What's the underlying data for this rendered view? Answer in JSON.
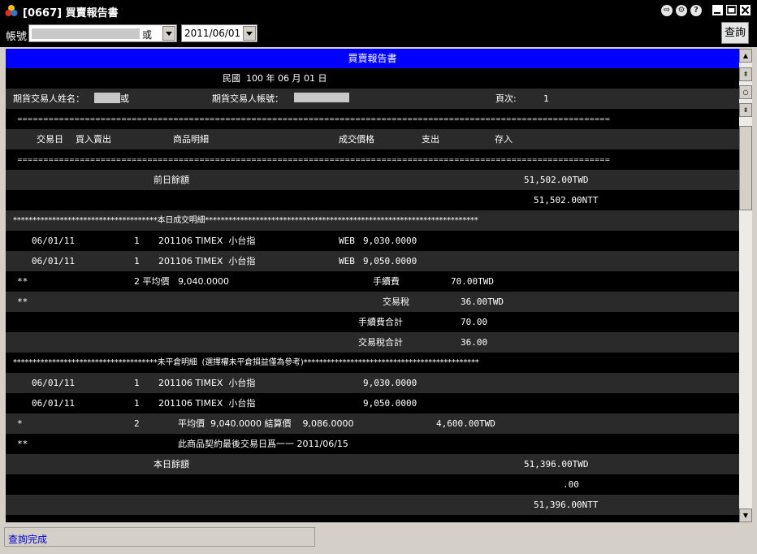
{
  "window": {
    "title": "[0667] 買賣報告書",
    "icons": [
      "app-logo-icon",
      "export-icon",
      "settings-icon",
      "help-icon",
      "minimize-icon",
      "maximize-icon",
      "close-icon"
    ]
  },
  "toolbar": {
    "account_label": "帳號",
    "account_value_suffix": "或",
    "date_value": "2011/06/01",
    "query_button": "查詢"
  },
  "report": {
    "header": "買賣報告書",
    "date_line": "民國  100 年 06 月 01 日",
    "trader_name_label": "期貨交易人姓名：",
    "trader_name_suffix": "或",
    "trader_account_label": "期貨交易人帳號：",
    "page_label": "頁次:",
    "page_value": "1",
    "separator": "==================================================================================================================",
    "columns": {
      "trade_date": "交易日",
      "buy_sell": "買入賣出",
      "product": "商品明細",
      "price": "成交價格",
      "expense": "支出",
      "deposit": "存入"
    },
    "prev_balance_label": "前日餘額",
    "prev_balance_twd": "51,502.00TWD",
    "prev_balance_ntt": "51,502.00NTT",
    "today_trades_title": "*************************************本日成交明細**********************************************************************",
    "trades": [
      {
        "date": "06/01/11",
        "qty": "1",
        "product": "201106 TIMEX  小台指",
        "channel": "WEB",
        "price": "9,030.0000"
      },
      {
        "date": "06/01/11",
        "qty": "1",
        "product": "201106 TIMEX  小台指",
        "channel": "WEB",
        "price": "9,050.0000"
      }
    ],
    "summary": {
      "marker": "**",
      "qty_avg": "2 平均價   9,040.0000",
      "fee_label": "手續費",
      "fee_value": "70.00TWD",
      "tax_marker": "**",
      "tax_label": "交易稅",
      "tax_value": "36.00TWD",
      "fee_total_label": "手續費合計",
      "fee_total_value": "70.00",
      "tax_total_label": "交易稅合計",
      "tax_total_value": "36.00"
    },
    "open_title": "*************************************未平倉明細  (選擇權未平倉損益僅為參考)*********************************************",
    "open_positions": [
      {
        "date": "06/01/11",
        "qty": "1",
        "product": "201106 TIMEX  小台指",
        "price": "9,030.0000"
      },
      {
        "date": "06/01/11",
        "qty": "1",
        "product": "201106 TIMEX  小台指",
        "price": "9,050.0000"
      }
    ],
    "open_summary": {
      "marker": "*",
      "qty": "2",
      "avg_text": "平均價  9,040.0000 結算價    9,086.0000",
      "pnl": "4,600.00TWD"
    },
    "last_trade_marker": "**",
    "last_trade_note": "此商品契約最後交易日爲一一 2011/06/15",
    "today_balance_label": "本日餘額",
    "today_balance_twd": "51,396.00TWD",
    "zero_value": ".00",
    "today_balance_ntt": "51,396.00NTT"
  },
  "status": {
    "text": "查詢完成"
  }
}
